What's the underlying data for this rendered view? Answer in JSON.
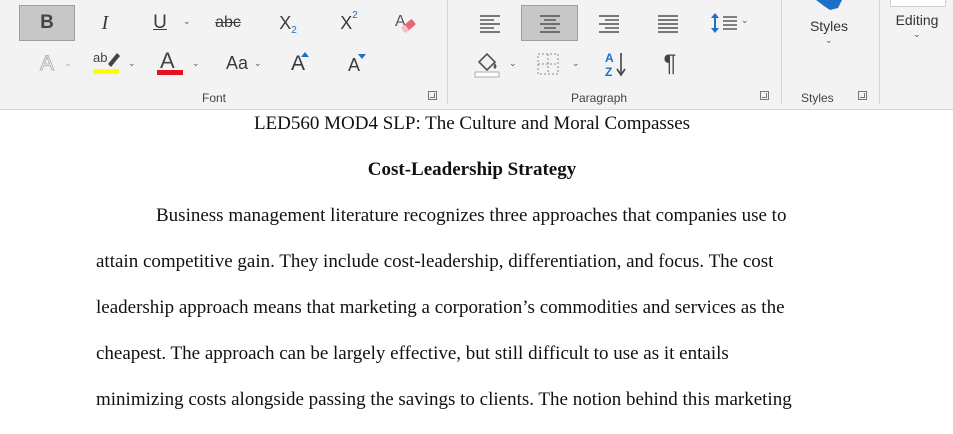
{
  "ribbon": {
    "font_group": {
      "label": "Font",
      "bold": "B",
      "italic": "I",
      "underline": "U",
      "strikethrough": "abc",
      "subscript_base": "X",
      "subscript_mark": "2",
      "superscript_base": "X",
      "superscript_mark": "2",
      "text_effects": "A",
      "highlight_text": "ab",
      "font_color": "A",
      "change_case": "Aa",
      "grow_font": "A",
      "shrink_font": "A",
      "highlight_color": "#ffff00",
      "font_color_value": "#e81123"
    },
    "paragraph_group": {
      "label": "Paragraph",
      "pilcrow": "¶",
      "sort_a": "A",
      "sort_z": "Z"
    },
    "styles_group": {
      "label": "Styles",
      "button": "Styles"
    },
    "editing_group": {
      "button": "Editing"
    }
  },
  "document": {
    "header_line": "LED560 MOD4 SLP: The Culture and Moral Compasses",
    "heading": "Cost-Leadership Strategy",
    "lines": [
      "Business management literature recognizes three approaches that companies use to",
      "attain competitive gain. They include cost-leadership, differentiation, and focus. The cost",
      "leadership approach means that marketing a corporation’s commodities and services as the",
      "cheapest. The approach can be largely effective, but still difficult to use as it entails",
      "minimizing costs alongside passing the savings to clients. The notion behind this marketing"
    ]
  }
}
